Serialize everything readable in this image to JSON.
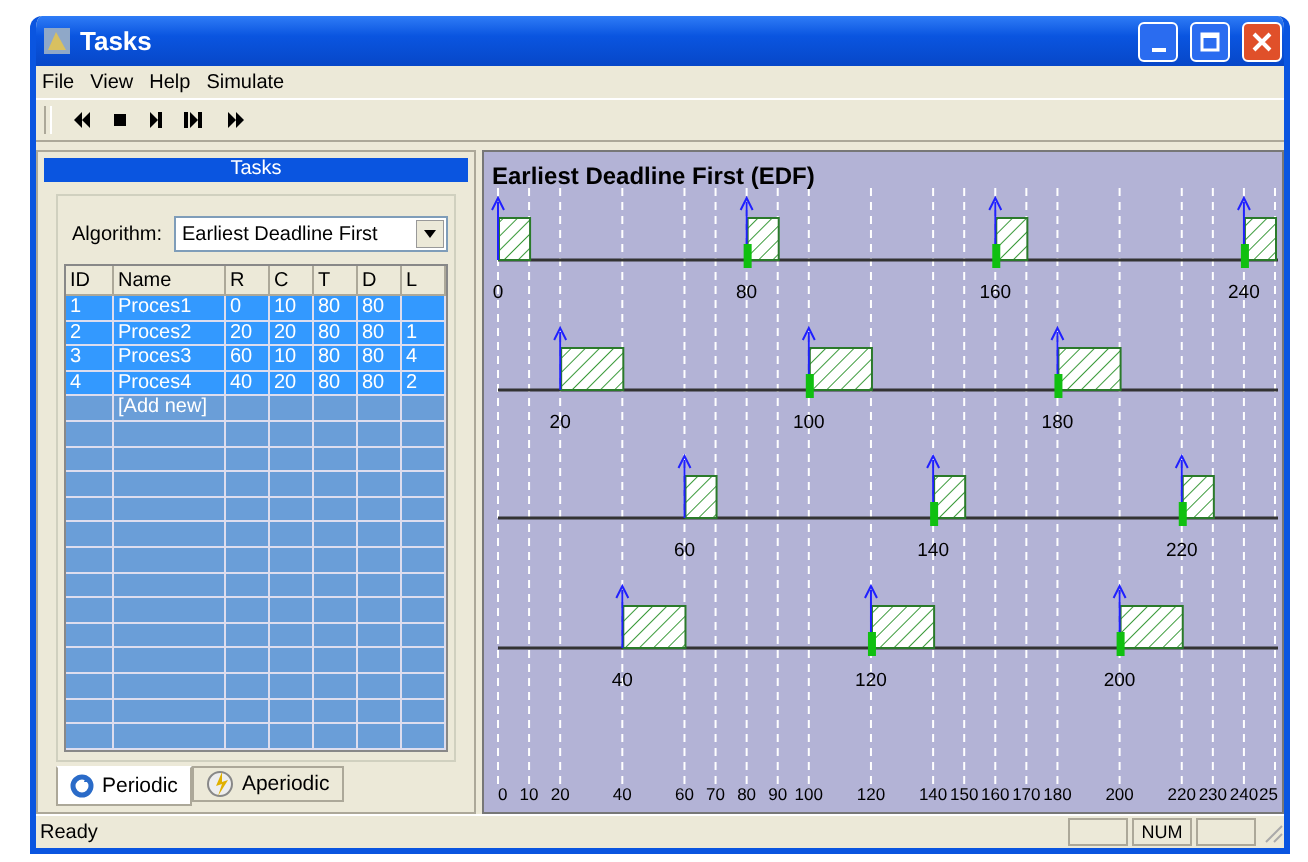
{
  "window": {
    "title": "Tasks"
  },
  "menu": [
    "File",
    "View",
    "Help",
    "Simulate"
  ],
  "tasks_panel": {
    "title": "Tasks",
    "algorithm_label": "Algorithm:",
    "algorithm_value": "Earliest Deadline First",
    "columns": [
      "ID",
      "Name",
      "R",
      "C",
      "T",
      "D",
      "L"
    ],
    "rows": [
      {
        "cells": [
          "1",
          "Proces1",
          "0",
          "10",
          "80",
          "80"
        ],
        "selected": true
      },
      {
        "cells": [
          "2",
          "Proces2",
          "20",
          "20",
          "80",
          "80",
          "1"
        ],
        "selected": true
      },
      {
        "cells": [
          "3",
          "Proces3",
          "60",
          "10",
          "80",
          "80",
          "4"
        ],
        "selected": true
      },
      {
        "cells": [
          "4",
          "Proces4",
          "40",
          "20",
          "80",
          "80",
          "2"
        ],
        "selected": true
      }
    ],
    "add_new_label": "[Add new]",
    "tabs": [
      {
        "label": "Periodic",
        "selected": true
      },
      {
        "label": "Aperiodic",
        "selected": false
      }
    ]
  },
  "schedule": {
    "title": "Earliest Deadline First (EDF)",
    "rows": [
      {
        "job_labels": [
          "0",
          "80",
          "160",
          "240"
        ]
      },
      {
        "job_labels": [
          "20",
          "100",
          "180"
        ]
      },
      {
        "job_labels": [
          "60",
          "140",
          "220"
        ]
      },
      {
        "job_labels": [
          "40",
          "120",
          "200"
        ]
      }
    ],
    "axis_labels": [
      "0",
      "10",
      "20",
      "40",
      "60",
      "70",
      "80",
      "90",
      "100",
      "120",
      "140",
      "150",
      "160",
      "170",
      "180",
      "200",
      "220",
      "230",
      "240",
      "25"
    ]
  },
  "status_bar": {
    "text": "Ready",
    "indicators": [
      "NUM"
    ]
  }
}
